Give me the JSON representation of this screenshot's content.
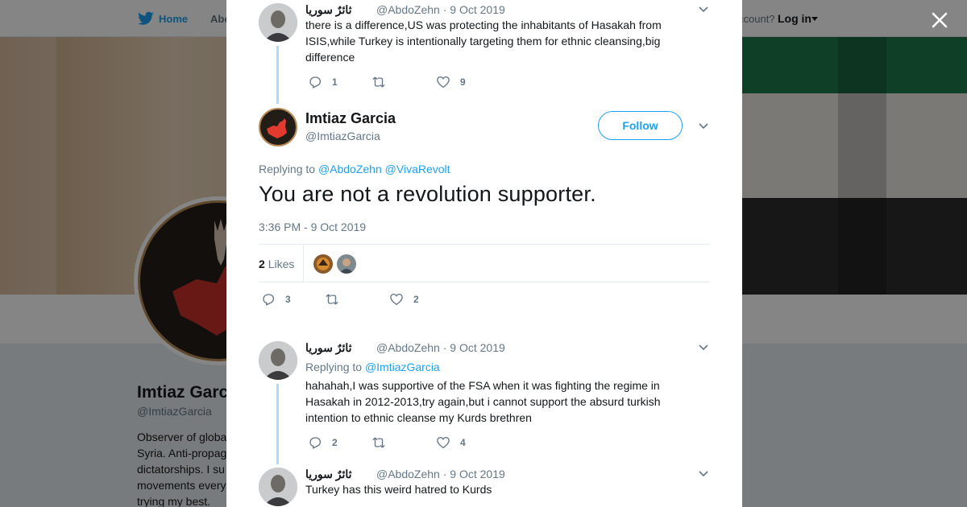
{
  "nav": {
    "home": "Home",
    "about_partial": "Abo",
    "account_partial": "ccount?",
    "login": "Log in"
  },
  "profile": {
    "name_partial": "Imtiaz Garc",
    "handle": "@ImtiazGarcia",
    "bio_lines": [
      "Observer of globa",
      "Syria. Anti-propag",
      "dictatorships. I su",
      "movements every",
      "trying my best."
    ]
  },
  "modal": {
    "parent_tweet": {
      "name": "ثائرٌ سوريا",
      "handle": "@AbdoZehn",
      "date": "9 Oct 2019",
      "text": "there is a difference,US was protecting the inhabitants of Hasakah from ISIS,while Turkey is intentionally targeting them for ethnic cleansing,big difference",
      "replies": "1",
      "retweets": "",
      "likes": "9"
    },
    "main_tweet": {
      "name": "Imtiaz Garcia",
      "handle": "@ImtiazGarcia",
      "follow_label": "Follow",
      "replying_to_label": "Replying to",
      "replying_to_1": "@AbdoZehn",
      "replying_to_2": "@VivaRevolt",
      "text": "You are not a revolution supporter.",
      "timestamp": "3:36 PM - 9 Oct 2019",
      "likes_count": "2",
      "likes_label": "Likes",
      "replies": "3",
      "retweets": "",
      "likes": "2"
    },
    "reply_1": {
      "name": "ثائرٌ سوريا",
      "handle": "@AbdoZehn",
      "date": "9 Oct 2019",
      "replying_to_label": "Replying to",
      "replying_to": "@ImtiazGarcia",
      "text": "hahahah,I was supportive of the FSA when it was fighting the regime in Hasakah in 2012-2013,try again,but i cannot support the absurd turkish intention to ethnic cleanse my Kurds brethren",
      "replies": "2",
      "retweets": "",
      "likes": "4"
    },
    "reply_2": {
      "name": "ثائرٌ سوريا",
      "handle": "@AbdoZehn",
      "date": "9 Oct 2019",
      "text": "Turkey has this weird hatred to Kurds"
    }
  },
  "colors": {
    "brand": "#1da1f2",
    "thread_line": "#aedcf7",
    "muted": "#657786"
  }
}
